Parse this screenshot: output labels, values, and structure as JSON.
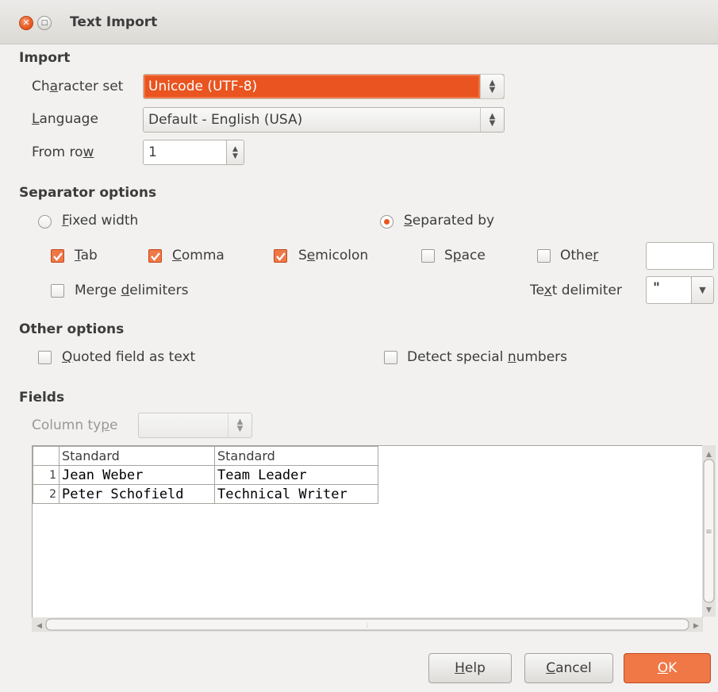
{
  "window": {
    "title": "Text Import",
    "close_icon": "close-icon",
    "maximize_icon": "maximize-icon"
  },
  "import": {
    "section_title": "Import",
    "charset_label": [
      "Ch",
      "a",
      "racter set"
    ],
    "charset_value": "Unicode (UTF-8)",
    "language_label": [
      "",
      "L",
      "anguage"
    ],
    "language_value": "Default - English (USA)",
    "from_row_label": [
      "From ro",
      "w",
      ""
    ],
    "from_row_value": "1"
  },
  "separator": {
    "section_title": "Separator options",
    "fixed_width": [
      "",
      "F",
      "ixed width"
    ],
    "separated_by": [
      "",
      "S",
      "eparated by"
    ],
    "selected_mode": "separated_by",
    "tab": [
      "",
      "T",
      "ab"
    ],
    "comma": [
      "",
      "C",
      "omma"
    ],
    "semicolon": [
      "S",
      "e",
      "micolon"
    ],
    "space": [
      "S",
      "p",
      "ace"
    ],
    "other": [
      "Othe",
      "r",
      ""
    ],
    "other_value": "",
    "checked": {
      "tab": true,
      "comma": true,
      "semicolon": true,
      "space": false,
      "other": false,
      "merge": false
    },
    "merge_delimiters": [
      "Merge ",
      "d",
      "elimiters"
    ],
    "text_delimiter_label": [
      "Te",
      "x",
      "t delimiter"
    ],
    "text_delimiter_value": "\""
  },
  "other_options": {
    "section_title": "Other options",
    "quoted_as_text": [
      "",
      "Q",
      "uoted field as text"
    ],
    "detect_numbers": [
      "Detect special ",
      "n",
      "umbers"
    ],
    "checked": {
      "quoted": false,
      "detect": false
    }
  },
  "fields": {
    "section_title": "Fields",
    "column_type_label": [
      "Column ty",
      "p",
      "e"
    ],
    "column_type_value": "",
    "headers": [
      "Standard",
      "Standard"
    ],
    "rows": [
      {
        "num": "1",
        "cells": [
          "Jean Weber",
          "Team Leader"
        ]
      },
      {
        "num": "2",
        "cells": [
          "Peter Schofield",
          "Technical Writer"
        ]
      }
    ]
  },
  "buttons": {
    "help": [
      "",
      "H",
      "elp"
    ],
    "cancel": [
      "",
      "C",
      "ancel"
    ],
    "ok": [
      "",
      "O",
      "K"
    ]
  },
  "colors": {
    "accent": "#e95420",
    "accent_light": "#f07746",
    "background": "#f2f1f0"
  }
}
